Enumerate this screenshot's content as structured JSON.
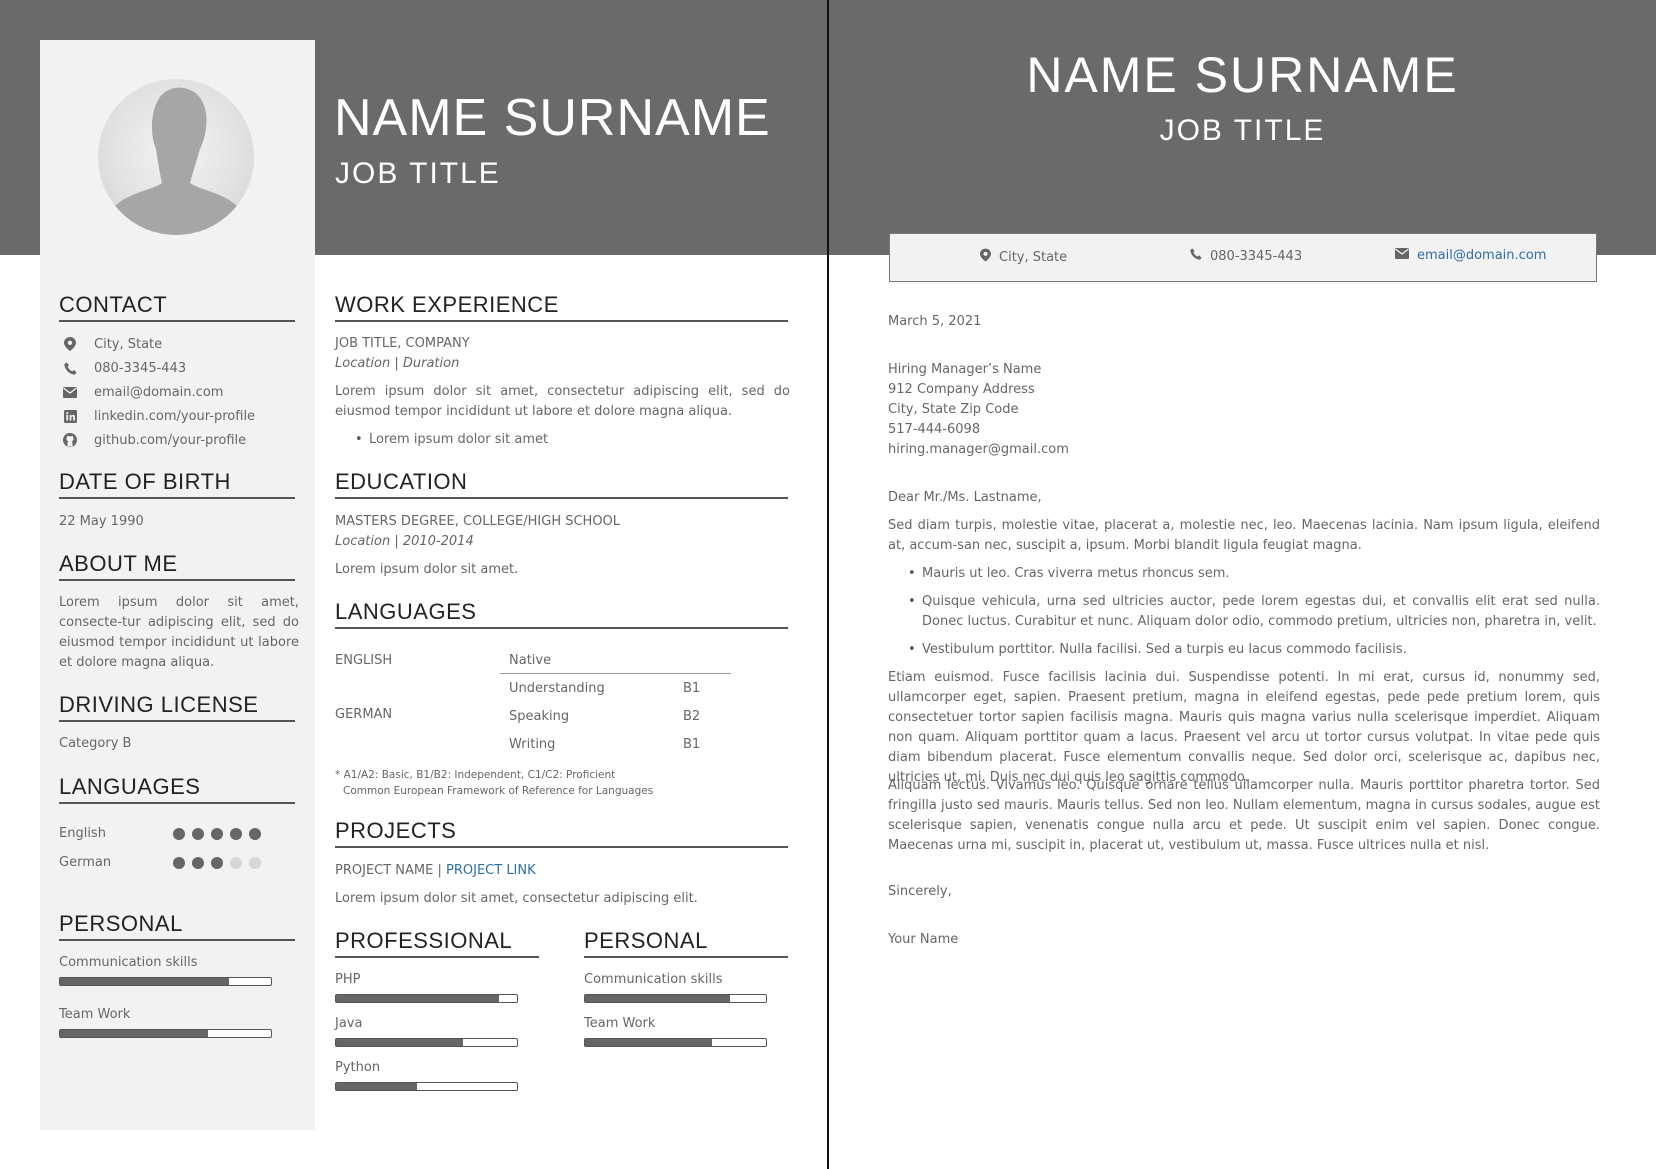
{
  "resume": {
    "name": "NAME SURNAME",
    "job_title": "JOB TITLE",
    "contact": {
      "heading": "CONTACT",
      "items": [
        {
          "icon": "location-icon",
          "text": "City, State",
          "link": false
        },
        {
          "icon": "phone-icon",
          "text": "080-3345-443",
          "link": false
        },
        {
          "icon": "email-icon",
          "text": "email@domain.com",
          "link": true
        },
        {
          "icon": "linkedin-icon",
          "text": "linkedin.com/your-profile",
          "link": true
        },
        {
          "icon": "github-icon",
          "text": "github.com/your-profile",
          "link": true
        }
      ]
    },
    "dob": {
      "heading": "DATE OF BIRTH",
      "value": "22 May 1990"
    },
    "about": {
      "heading": "ABOUT ME",
      "text": "Lorem ipsum dolor sit amet, consecte-tur adipiscing elit, sed do eiusmod tempor incididunt ut labore et dolore magna aliqua."
    },
    "license": {
      "heading": "DRIVING LICENSE",
      "value": "Category B"
    },
    "side_languages": {
      "heading": "LANGUAGES",
      "items": [
        {
          "name": "English",
          "level": 5,
          "max": 5
        },
        {
          "name": "German",
          "level": 3,
          "max": 5
        }
      ]
    },
    "personal": {
      "heading": "PERSONAL",
      "skills": [
        {
          "name": "Communication skills",
          "level": 0.8
        },
        {
          "name": "Team Work",
          "level": 0.7
        }
      ]
    },
    "work": {
      "heading": "WORK EXPERIENCE",
      "role": "JOB TITLE, COMPANY",
      "meta": "Location | Duration",
      "description": "Lorem ipsum dolor sit amet, consectetur adipiscing elit, sed do eiusmod tempor incididunt ut labore et dolore magna aliqua.",
      "bullet": "Lorem ipsum dolor sit amet"
    },
    "education": {
      "heading": "EDUCATION",
      "degree": "MASTERS DEGREE, COLLEGE/HIGH SCHOOL",
      "meta": "Location | 2010-2014",
      "description": "Lorem ipsum dolor sit amet."
    },
    "languages": {
      "heading": "LANGUAGES",
      "english": {
        "name": "ENGLISH",
        "level": "Native"
      },
      "german": {
        "name": "GERMAN",
        "rows": [
          {
            "skill": "Understanding",
            "level": "B1"
          },
          {
            "skill": "Speaking",
            "level": "B2"
          },
          {
            "skill": "Writing",
            "level": "B1"
          }
        ]
      },
      "note": "* A1/A2: Basic, B1/B2: Independent, C1/C2: Proficient",
      "framework_link": "Common European Framework of Reference for Languages"
    },
    "projects": {
      "heading": "PROJECTS",
      "name": "PROJECT NAME |",
      "link": "PROJECT LINK",
      "description": "Lorem ipsum dolor sit amet, consectetur adipiscing elit."
    },
    "professional": {
      "heading": "PROFESSIONAL",
      "skills": [
        {
          "name": "PHP",
          "level": 0.9
        },
        {
          "name": "Java",
          "level": 0.7
        },
        {
          "name": "Python",
          "level": 0.45
        }
      ]
    },
    "personal_main": {
      "heading": "PERSONAL",
      "skills": [
        {
          "name": "Communication skills",
          "level": 0.8
        },
        {
          "name": "Team Work",
          "level": 0.7
        }
      ]
    }
  },
  "letter": {
    "name": "NAME SURNAME",
    "job_title": "JOB TITLE",
    "contact": {
      "location": "City, State",
      "phone": "080-3345-443",
      "email": "email@domain.com"
    },
    "date": "March 5, 2021",
    "recipient": [
      "Hiring Manager’s Name",
      "912 Company Address",
      "City, State Zip Code",
      "517-444-6098",
      "hiring.manager@gmail.com"
    ],
    "salutation": "Dear Mr./Ms. Lastname,",
    "intro": "Sed diam turpis, molestie vitae, placerat a, molestie nec, leo. Maecenas lacinia. Nam ipsum ligula, eleifend at, accum-san nec, suscipit a, ipsum. Morbi blandit ligula feugiat magna.",
    "bullets": [
      "Mauris ut leo. Cras viverra metus rhoncus sem.",
      "Quisque vehicula, urna sed ultricies auctor, pede lorem egestas dui, et convallis elit erat sed nulla. Donec luctus. Curabitur et nunc. Aliquam dolor odio, commodo pretium, ultricies non, pharetra in, velit.",
      "Vestibulum porttitor. Nulla facilisi. Sed a turpis eu lacus commodo facilisis."
    ],
    "para1": "Etiam euismod. Fusce facilisis lacinia dui. Suspendisse potenti. In mi erat, cursus id, nonummy sed, ullamcorper eget, sapien. Praesent pretium, magna in eleifend egestas, pede pede pretium lorem, quis consectetuer tortor sapien facilisis magna. Mauris quis magna varius nulla scelerisque imperdiet. Aliquam non quam. Aliquam porttitor quam a lacus. Praesent vel arcu ut tortor cursus volutpat. In vitae pede quis diam bibendum placerat. Fusce elementum convallis neque. Sed dolor orci, scelerisque ac, dapibus nec, ultricies ut, mi. Duis nec dui quis leo sagittis commodo.",
    "para2": "Aliquam lectus. Vivamus leo. Quisque ornare tellus ullamcorper nulla. Mauris porttitor pharetra tortor. Sed fringilla justo sed mauris. Mauris tellus. Sed non leo. Nullam elementum, magna in cursus sodales, augue est scelerisque sapien, venenatis congue nulla arcu et pede. Ut suscipit enim vel sapien. Donec congue. Maecenas urna mi, suscipit in, placerat ut, vestibulum ut, massa. Fusce ultrices nulla et nisl.",
    "closing": "Sincerely,",
    "signature": "Your Name"
  },
  "colors": {
    "header": "#6a6a6a",
    "sidebar": "#f2f2f2",
    "link": "#2f6ea5",
    "bar_fill": "#666666"
  }
}
